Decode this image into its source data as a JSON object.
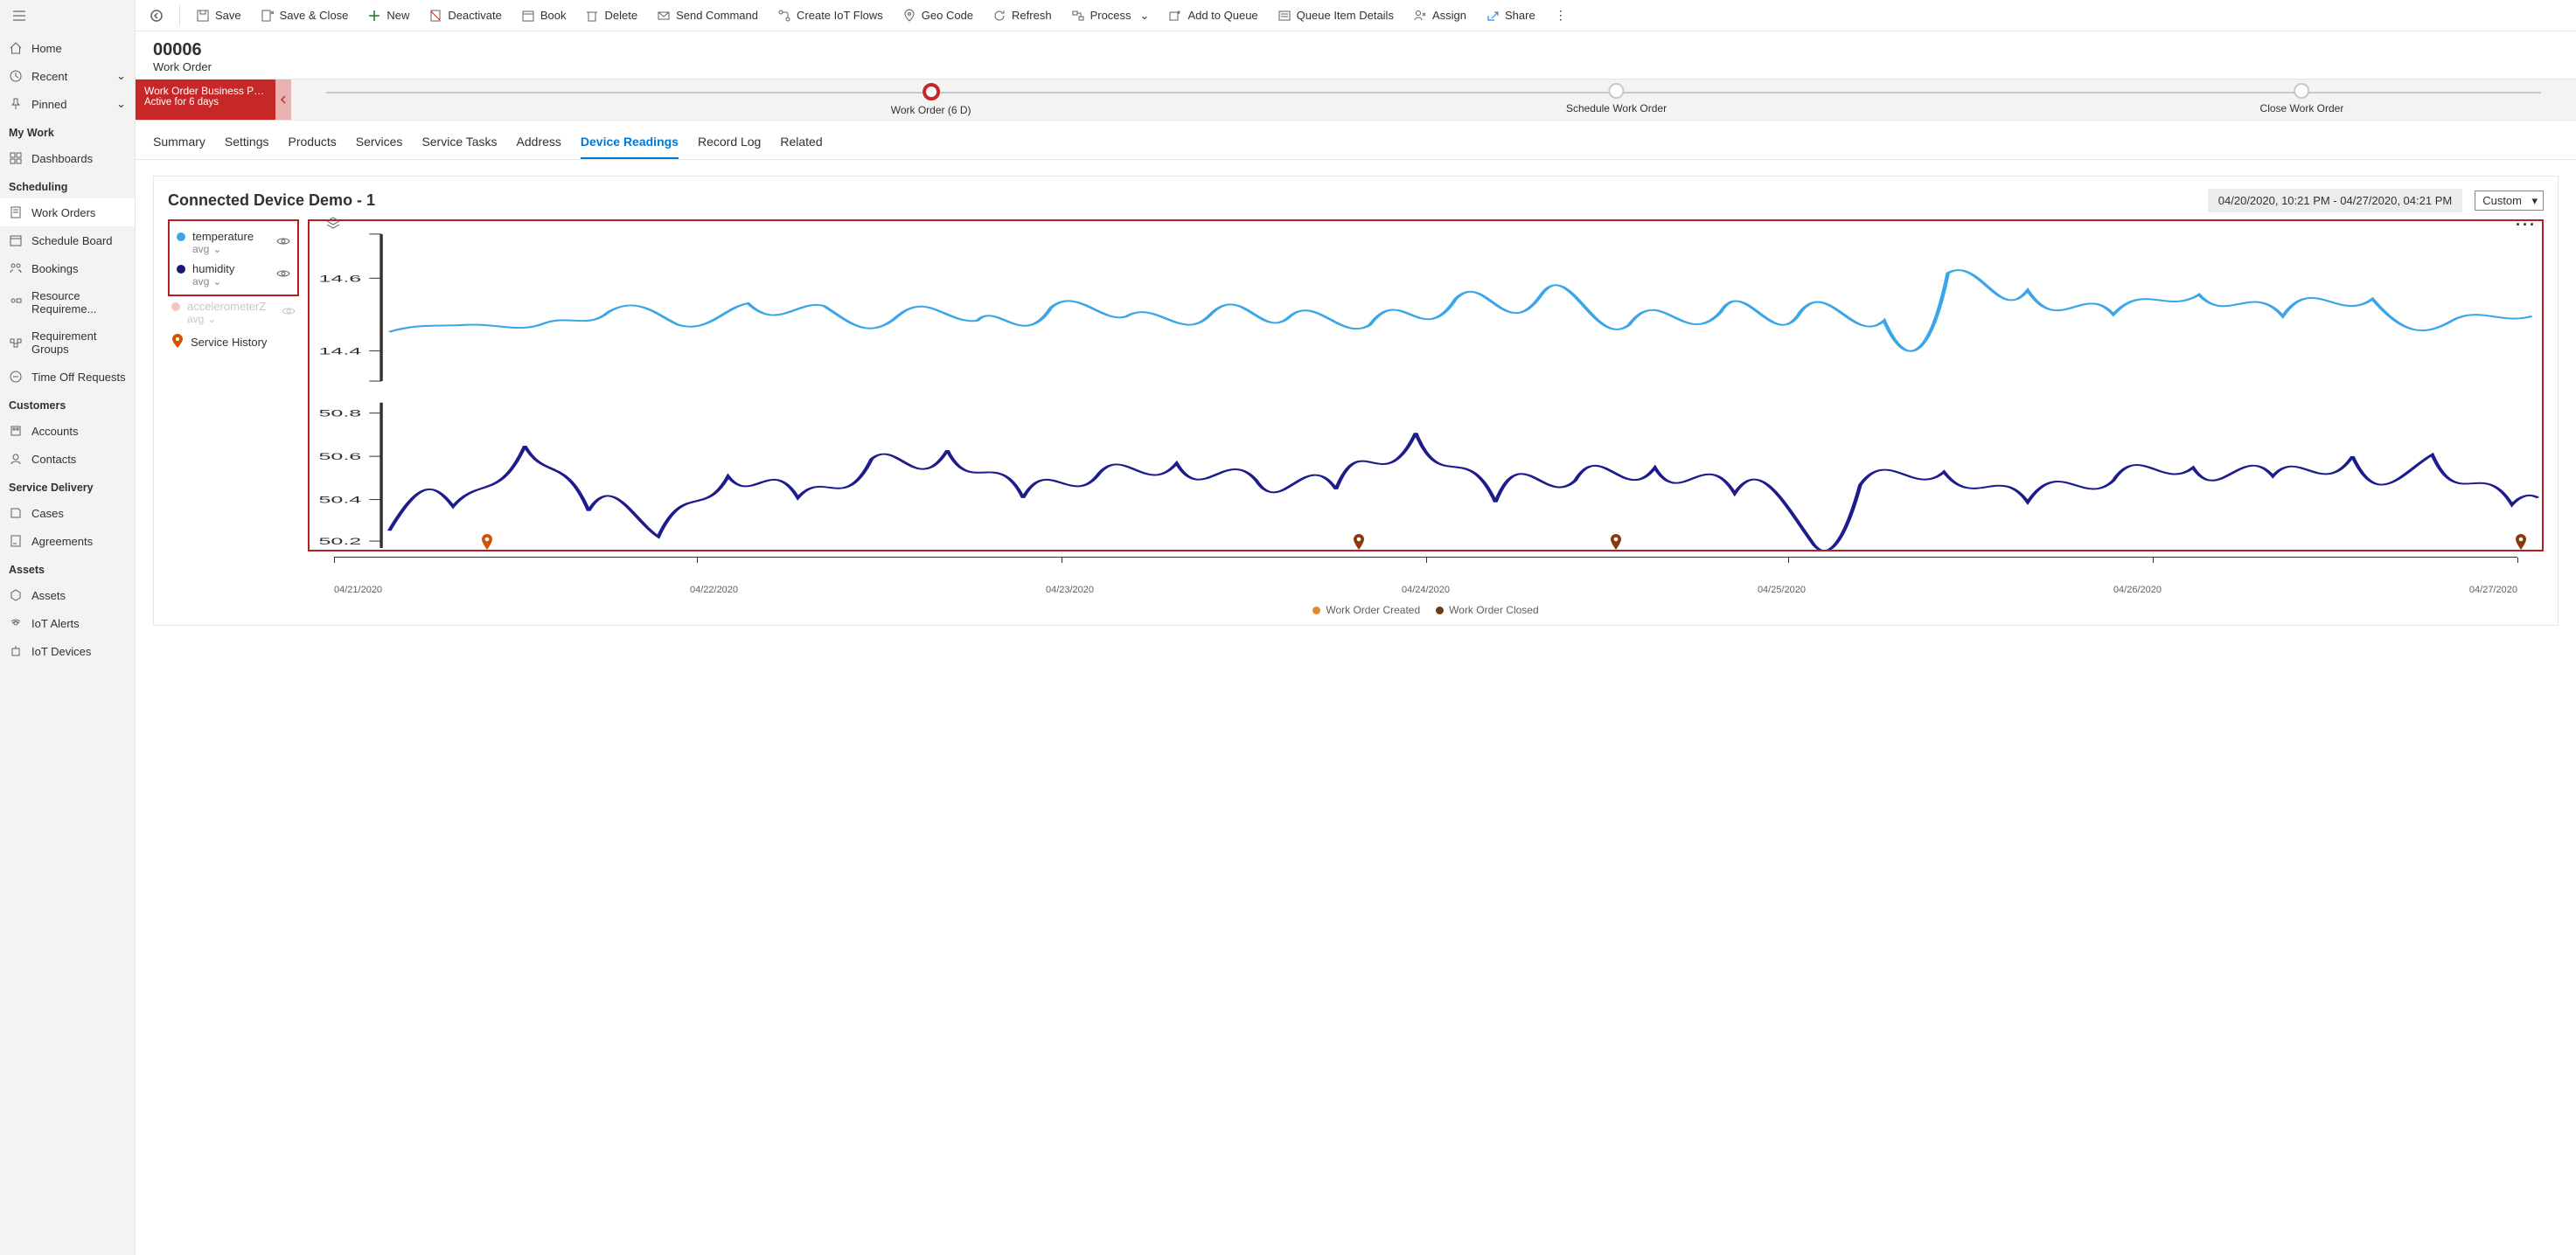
{
  "sidebar": {
    "home": "Home",
    "recent": "Recent",
    "pinned": "Pinned",
    "groups": [
      {
        "label": "My Work",
        "items": [
          {
            "label": "Dashboards"
          }
        ]
      },
      {
        "label": "Scheduling",
        "items": [
          {
            "label": "Work Orders",
            "active": true
          },
          {
            "label": "Schedule Board"
          },
          {
            "label": "Bookings"
          },
          {
            "label": "Resource Requireme..."
          },
          {
            "label": "Requirement Groups"
          },
          {
            "label": "Time Off Requests"
          }
        ]
      },
      {
        "label": "Customers",
        "items": [
          {
            "label": "Accounts"
          },
          {
            "label": "Contacts"
          }
        ]
      },
      {
        "label": "Service Delivery",
        "items": [
          {
            "label": "Cases"
          },
          {
            "label": "Agreements"
          }
        ]
      },
      {
        "label": "Assets",
        "items": [
          {
            "label": "Assets"
          },
          {
            "label": "IoT Alerts"
          },
          {
            "label": "IoT Devices"
          }
        ]
      }
    ]
  },
  "commands": {
    "save": "Save",
    "saveClose": "Save & Close",
    "new": "New",
    "deactivate": "Deactivate",
    "book": "Book",
    "delete": "Delete",
    "sendCommand": "Send Command",
    "createIot": "Create IoT Flows",
    "geoCode": "Geo Code",
    "refresh": "Refresh",
    "process": "Process",
    "addQueue": "Add to Queue",
    "queueDetails": "Queue Item Details",
    "assign": "Assign",
    "share": "Share"
  },
  "record": {
    "title": "00006",
    "subtitle": "Work Order"
  },
  "bpf": {
    "name": "Work Order Business Pro...",
    "activeFor": "Active for 6 days",
    "stages": [
      {
        "label": "Work Order  (6 D)",
        "pos": 25,
        "active": true
      },
      {
        "label": "Schedule Work Order",
        "pos": 55,
        "active": false
      },
      {
        "label": "Close Work Order",
        "pos": 85,
        "active": false
      }
    ]
  },
  "tabs": [
    {
      "label": "Summary"
    },
    {
      "label": "Settings"
    },
    {
      "label": "Products"
    },
    {
      "label": "Services"
    },
    {
      "label": "Service Tasks"
    },
    {
      "label": "Address"
    },
    {
      "label": "Device Readings",
      "active": true
    },
    {
      "label": "Record Log"
    },
    {
      "label": "Related"
    }
  ],
  "chart": {
    "title": "Connected Device Demo - 1",
    "rangeText": "04/20/2020, 10:21 PM - 04/27/2020, 04:21 PM",
    "rangeSelect": "Custom",
    "series": [
      {
        "name": "temperature",
        "agg": "avg",
        "color": "#3AA6E8"
      },
      {
        "name": "humidity",
        "agg": "avg",
        "color": "#17177A"
      },
      {
        "name": "accelerometerZ",
        "agg": "avg",
        "color": "#f5c4c0",
        "muted": true
      }
    ],
    "serviceHistory": "Service History",
    "xTicks": [
      "04/21/2020",
      "04/22/2020",
      "04/23/2020",
      "04/24/2020",
      "04/25/2020",
      "04/26/2020",
      "04/27/2020"
    ],
    "tempTicks": [
      "14.6",
      "14.4"
    ],
    "humTicks": [
      "50.8",
      "50.6",
      "50.4",
      "50.2"
    ],
    "footer": {
      "created": "Work Order Created",
      "closed": "Work Order Closed"
    },
    "pins": [
      8,
      47,
      58.5,
      82
    ],
    "chart_data": {
      "type": "line",
      "x_axis_dates": [
        "04/21/2020",
        "04/22/2020",
        "04/23/2020",
        "04/24/2020",
        "04/25/2020",
        "04/26/2020",
        "04/27/2020"
      ],
      "series": [
        {
          "name": "temperature",
          "agg": "avg",
          "approx_range": [
            14.35,
            14.7
          ],
          "y_ticks": [
            14.4,
            14.6
          ]
        },
        {
          "name": "humidity",
          "agg": "avg",
          "approx_range": [
            50.15,
            50.85
          ],
          "y_ticks": [
            50.2,
            50.4,
            50.6,
            50.8
          ]
        }
      ],
      "markers": {
        "work_order_created_color": "#e08a2c",
        "work_order_closed_color": "#6b3a1a",
        "marker_positions_pct_of_x": [
          8,
          47,
          58.5,
          82
        ]
      }
    }
  }
}
